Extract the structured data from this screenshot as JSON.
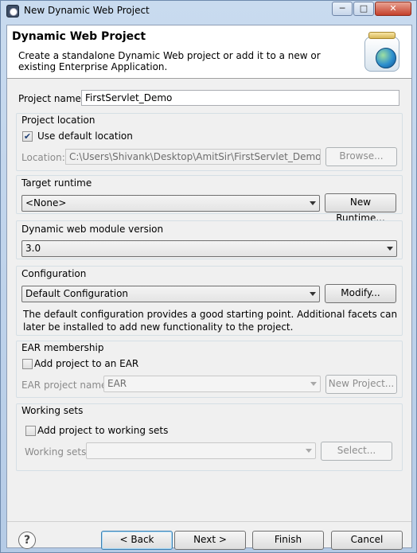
{
  "window": {
    "title": "New Dynamic Web Project",
    "minimize": "─",
    "maximize": "□",
    "close": "✕"
  },
  "banner": {
    "title": "Dynamic Web Project",
    "description": "Create a standalone Dynamic Web project or add it to a new or existing Enterprise Application.",
    "icon": "web-project-jar-globe-icon"
  },
  "project": {
    "name_label": "Project name:",
    "name_value": "FirstServlet_Demo"
  },
  "location": {
    "group_title": "Project location",
    "use_default_label": "Use default location",
    "use_default_checked": true,
    "check_glyph": "✔",
    "location_label": "Location:",
    "location_value": "C:\\Users\\Shivank\\Desktop\\AmitSir\\FirstServlet_Demo",
    "browse_label": "Browse..."
  },
  "target_runtime": {
    "group_title": "Target runtime",
    "selected": "<None>",
    "new_runtime_label": "New Runtime..."
  },
  "module_version": {
    "group_title": "Dynamic web module version",
    "selected": "3.0"
  },
  "configuration": {
    "group_title": "Configuration",
    "selected": "Default Configuration",
    "modify_label": "Modify...",
    "description": "The default configuration provides a good starting point. Additional facets can later be installed to add new functionality to the project."
  },
  "ear": {
    "group_title": "EAR membership",
    "add_label": "Add project to an EAR",
    "add_checked": false,
    "project_name_label": "EAR project name:",
    "project_name_value": "EAR",
    "new_project_label": "New Project..."
  },
  "working_sets": {
    "group_title": "Working sets",
    "add_label": "Add project to working sets",
    "add_checked": false,
    "working_sets_label": "Working sets:",
    "working_sets_value": "",
    "select_label": "Select..."
  },
  "footer": {
    "help_glyph": "?",
    "back_label": "< Back",
    "next_label": "Next >",
    "finish_label": "Finish",
    "cancel_label": "Cancel"
  }
}
